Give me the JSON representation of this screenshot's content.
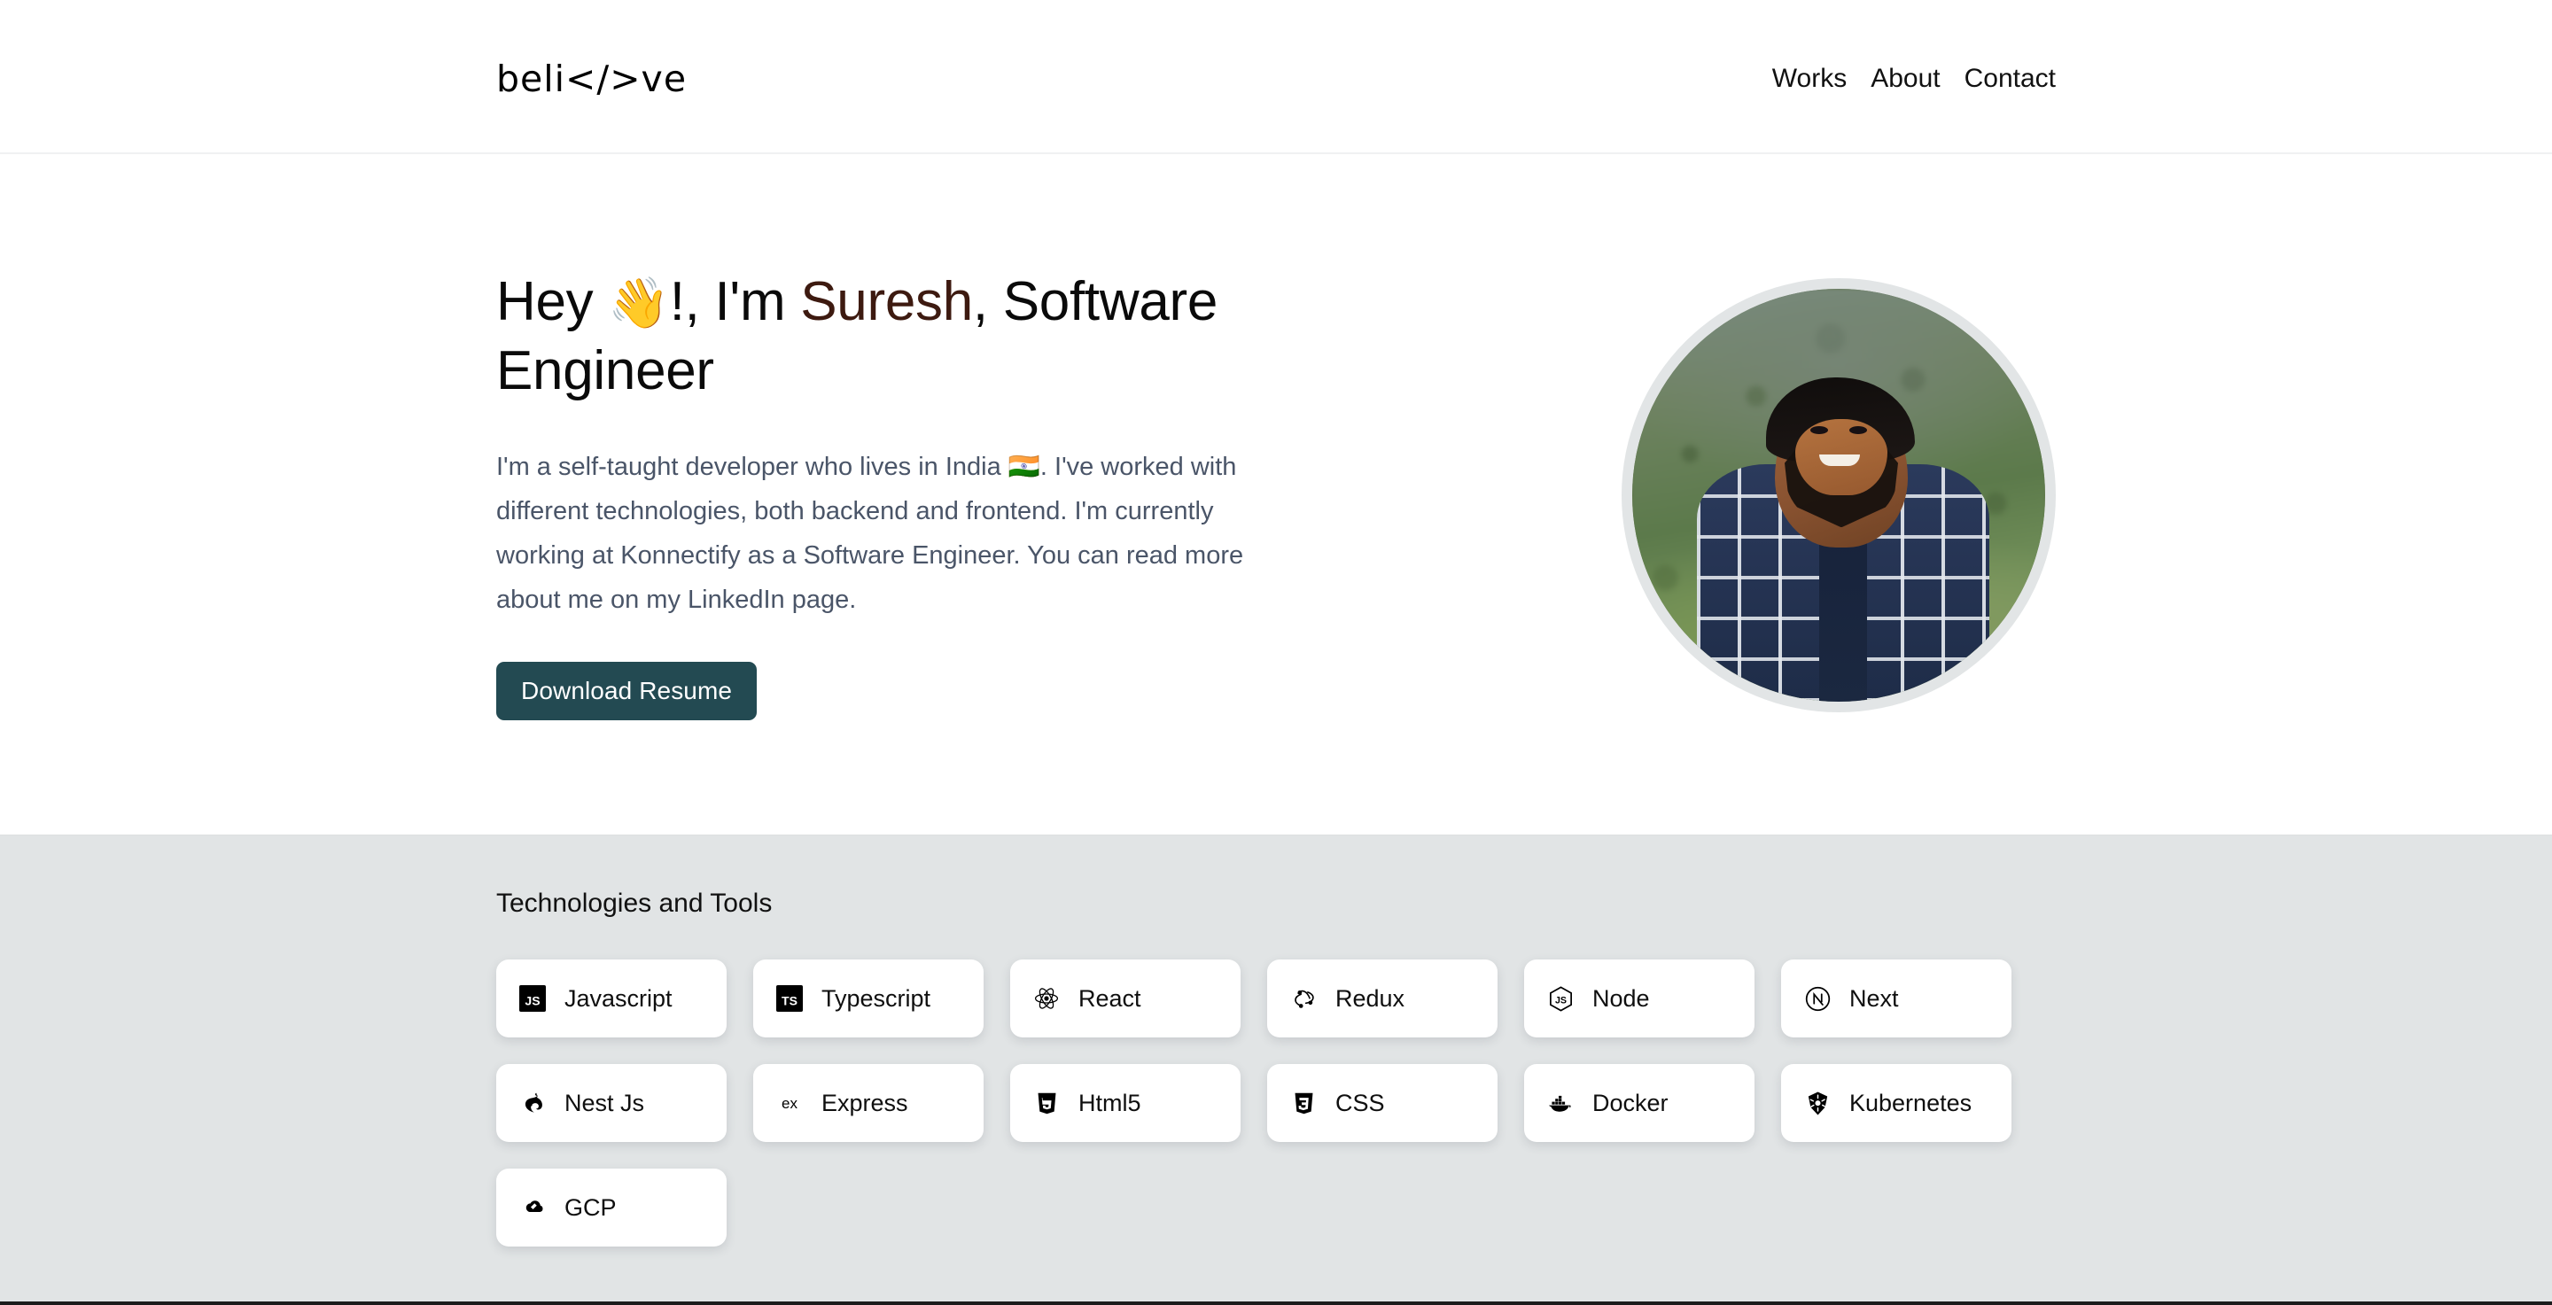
{
  "header": {
    "logo": "beli</>ve",
    "nav": [
      {
        "label": "Works",
        "name": "nav-link-works"
      },
      {
        "label": "About",
        "name": "nav-link-about"
      },
      {
        "label": "Contact",
        "name": "nav-link-contact"
      }
    ]
  },
  "hero": {
    "greeting": "Hey ",
    "wave_emoji": "👋",
    "title_before_name": "!, I'm ",
    "name": "Suresh",
    "title_after_name": ", Software Engineer",
    "description": "I'm a self-taught developer who lives in India 🇮🇳. I've worked with different technologies, both backend and frontend. I'm currently working at Konnectify as a Software Engineer. You can read more about me on my LinkedIn page.",
    "resume_button": "Download Resume",
    "avatar_alt": "Profile photo of Suresh standing outdoors in a navy plaid shirt",
    "accent_color": "#3d1a10",
    "button_color": "#234a52"
  },
  "tech": {
    "heading": "Technologies and Tools",
    "section_bg": "#e1e4e5",
    "items": [
      {
        "label": "Javascript",
        "icon": "javascript-icon"
      },
      {
        "label": "Typescript",
        "icon": "typescript-icon"
      },
      {
        "label": "React",
        "icon": "react-icon"
      },
      {
        "label": "Redux",
        "icon": "redux-icon"
      },
      {
        "label": "Node",
        "icon": "node-icon"
      },
      {
        "label": "Next",
        "icon": "next-icon"
      },
      {
        "label": "Nest Js",
        "icon": "nestjs-icon"
      },
      {
        "label": "Express",
        "icon": "express-icon"
      },
      {
        "label": "Html5",
        "icon": "html5-icon"
      },
      {
        "label": "CSS",
        "icon": "css-icon"
      },
      {
        "label": "Docker",
        "icon": "docker-icon"
      },
      {
        "label": "Kubernetes",
        "icon": "kubernetes-icon"
      },
      {
        "label": "GCP",
        "icon": "gcp-icon"
      }
    ]
  }
}
